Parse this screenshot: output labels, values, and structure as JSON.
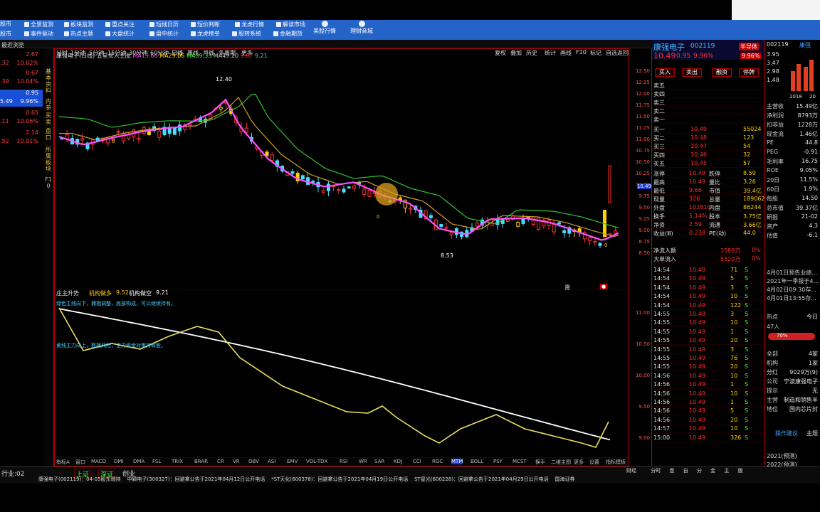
{
  "toolbar": {
    "row1": [
      "全景监测",
      "板块监测",
      "重点关注",
      "短线日历",
      "短价判断",
      "龙虎行情",
      "解读市场"
    ],
    "row2": [
      "事件驱动",
      "热点主题",
      "大盘统计",
      "盘中统计",
      "龙虎榜单",
      "股转系统",
      "金融期货",
      "美股行情",
      "理财商城"
    ],
    "left_labels": [
      "股市",
      "股市"
    ]
  },
  "left_panel": {
    "header": [
      "最近浏览"
    ],
    "rows": [
      {
        "a": "",
        "b": "2.67"
      },
      {
        "a": ".32",
        "b": "10.02%"
      },
      {
        "a": "",
        "b": "0.67"
      },
      {
        "a": ".39",
        "b": "10.04%"
      },
      {
        "a": "",
        "b": "0.95"
      },
      {
        "a": "5.49",
        "b": "9.96%"
      },
      {
        "a": "",
        "b": "0.65"
      },
      {
        "a": ".11",
        "b": "10.06%"
      },
      {
        "a": "",
        "b": "2.14"
      },
      {
        "a": ".52",
        "b": "10.01%"
      }
    ]
  },
  "vtabs": [
    "基本资料",
    "内参",
    "买卖",
    "盘口",
    "所属板块",
    "F10"
  ],
  "chart_header": {
    "periods": [
      "分时",
      "1分钟",
      "5分钟",
      "15分钟",
      "30分钟",
      "60分钟",
      "日线",
      "周线",
      "月线",
      "多周期",
      "更多"
    ],
    "right_tools": [
      "复权",
      "叠加",
      "历史",
      "统计",
      "画线",
      "F10",
      "标记",
      "自选",
      "返回"
    ],
    "stock_label": "康强电子(日线)",
    "indicator": "五星买入主图",
    "ma": [
      {
        "name": "MA1",
        "val": "9.66",
        "color": "#ff40ff"
      },
      {
        "name": "MA2",
        "val": "9.06",
        "color": "#ffd000"
      },
      {
        "name": "MA3",
        "val": "9.33",
        "color": "#40ff40"
      },
      {
        "name": "MA4",
        "val": "9.20",
        "color": "#c0c0c0"
      },
      {
        "name": "",
        "val": "9.87",
        "color": "#ff3030"
      },
      {
        "name": "",
        "val": "9.21",
        "color": "#40d0ff"
      }
    ]
  },
  "chart_data": {
    "type": "line",
    "price_high_label": "12.40",
    "price_low_label": "8.53",
    "tick_marks": [
      "0",
      "0",
      "0"
    ]
  },
  "indicator_panel": {
    "title": "庄主升势",
    "label1": "机构做多",
    "val1": "9.52",
    "label2": "机构做空",
    "val2": "9.21",
    "note1": "绿色主线向下，拥抱调整，底部构成，可以继续持有。",
    "note2": "黄线主力向上，数据风险，主力资金对策持有股。",
    "marker": "贤"
  },
  "bottom_tabs": [
    "指标A",
    "窗口",
    "MACD",
    "DMI",
    "DMA",
    "FSL",
    "TRIX",
    "BRAR",
    "CR",
    "VR",
    "OBV",
    "ASI",
    "EMV",
    "VOL-TDX",
    "RSI",
    "WR",
    "SAR",
    "KDJ",
    "CCI",
    "ROC",
    "MTM",
    "BOLL",
    "PSY",
    "MCST",
    "换手",
    "二维主图",
    "更多",
    "设置"
  ],
  "bottom_tabs_right": "指标模板",
  "axis_prices": [
    "12.50",
    "12.25",
    "12.00",
    "11.75",
    "11.50",
    "11.25",
    "11.00",
    "10.75",
    "10.50",
    "10.25",
    "10.00",
    "9.75",
    "9.50",
    "9.25",
    "9.00",
    "8.75",
    "8.50"
  ],
  "axis_lower": [
    "11.00",
    "10.50",
    "10.00",
    "9.50",
    "9.00"
  ],
  "quote": {
    "name": "康强电子",
    "code": "002119",
    "price": "10.49",
    "change": "0.95",
    "pct": "9.96%",
    "flag": "半导体",
    "flag2": "9.96%",
    "buttons": [
      "买入",
      "卖出",
      "融资",
      "停牌"
    ],
    "sell": [
      "卖五",
      "卖四",
      "卖三",
      "卖二",
      "卖一"
    ],
    "buy": [
      {
        "k": "买一",
        "p": "10.49",
        "v": "55024"
      },
      {
        "k": "买二",
        "p": "10.48",
        "v": "123"
      },
      {
        "k": "买三",
        "p": "10.47",
        "v": "54"
      },
      {
        "k": "买四",
        "p": "10.46",
        "v": "32"
      },
      {
        "k": "买五",
        "p": "10.45",
        "v": "57"
      }
    ],
    "stats": [
      {
        "k1": "涨停",
        "v1": "10.49",
        "k2": "跌停",
        "v2": "8.59"
      },
      {
        "k1": "最高",
        "v1": "10.49",
        "k2": "量比",
        "v2": "3.26"
      },
      {
        "k1": "最低",
        "v1": "9.66",
        "k2": "市值",
        "v2": "39.4亿"
      },
      {
        "k1": "现量",
        "v1": "326",
        "k2": "总量",
        "v2": "189062"
      },
      {
        "k1": "外盘",
        "v1": "102810",
        "k2": "内盘",
        "v2": "86244"
      },
      {
        "k1": "换手",
        "v1": "5.14%",
        "k2": "股本",
        "v2": "3.75亿"
      },
      {
        "k1": "净资",
        "v1": "2.59",
        "k2": "流通",
        "v2": "3.66亿"
      },
      {
        "k1": "收益(Ⅲ)",
        "v1": "0.238",
        "k2": "PE(动)",
        "v2": "44.0"
      }
    ],
    "flow": [
      {
        "k": "净流入额",
        "v": "1589万",
        "p": "0%"
      },
      {
        "k": "大单流入",
        "v": "5520万",
        "p": "0%"
      }
    ],
    "ticks": [
      {
        "t": "14:54",
        "p": "10.49",
        "v": "71",
        "s": "S"
      },
      {
        "t": "14:54",
        "p": "10.49",
        "v": "5",
        "s": "S"
      },
      {
        "t": "14:54",
        "p": "10.49",
        "v": "3",
        "s": "S"
      },
      {
        "t": "14:54",
        "p": "10.49",
        "v": "10",
        "s": "S"
      },
      {
        "t": "14:54",
        "p": "10.49",
        "v": "122",
        "s": "S"
      },
      {
        "t": "14:55",
        "p": "10.49",
        "v": "3",
        "s": "S"
      },
      {
        "t": "14:55",
        "p": "10.49",
        "v": "10",
        "s": "S"
      },
      {
        "t": "14:55",
        "p": "10.49",
        "v": "1",
        "s": "S"
      },
      {
        "t": "14:55",
        "p": "10.49",
        "v": "20",
        "s": "S"
      },
      {
        "t": "14:55",
        "p": "10.49",
        "v": "3",
        "s": "S"
      },
      {
        "t": "14:55",
        "p": "10.49",
        "v": "76",
        "s": "S"
      },
      {
        "t": "14:55",
        "p": "10.49",
        "v": "20",
        "s": "S"
      },
      {
        "t": "14:56",
        "p": "10.49",
        "v": "10",
        "s": "S"
      },
      {
        "t": "14:56",
        "p": "10.49",
        "v": "1",
        "s": "S"
      },
      {
        "t": "14:56",
        "p": "10.49",
        "v": "10",
        "s": "S"
      },
      {
        "t": "14:56",
        "p": "10.49",
        "v": "1",
        "s": "S"
      },
      {
        "t": "14:56",
        "p": "10.49",
        "v": "5",
        "s": "S"
      },
      {
        "t": "14:56",
        "p": "10.49",
        "v": "20",
        "s": "S"
      },
      {
        "t": "14:57",
        "p": "10.49",
        "v": "10",
        "s": "S"
      },
      {
        "t": "15:00",
        "p": "10.49",
        "v": "326",
        "s": "S"
      }
    ]
  },
  "fin": {
    "code": "002119",
    "tag": "康强",
    "bars": [
      "3.95",
      "3.47",
      "2.98",
      "1.48"
    ],
    "years": [
      "2018",
      "20"
    ],
    "rows": [
      {
        "k": "主营收",
        "v": "15.49亿"
      },
      {
        "k": "净利润",
        "v": "8793万"
      },
      {
        "k": "扣非益",
        "v": "1228万"
      },
      {
        "k": "现金流",
        "v": "1.46亿"
      },
      {
        "k": "PE",
        "v": "44.8"
      },
      {
        "k": "PEG",
        "v": "-0.91"
      },
      {
        "k": "毛利率",
        "v": "16.75"
      },
      {
        "k": "ROE",
        "v": "9.05%"
      },
      {
        "k": "20日",
        "v": "11.5%"
      },
      {
        "k": "60日",
        "v": "1.9%"
      },
      {
        "k": "每股",
        "v": "14.50"
      },
      {
        "k": "总市值",
        "v": "39.37亿"
      },
      {
        "k": "研报",
        "v": "21-02"
      },
      {
        "k": "资产",
        "v": "4.3"
      },
      {
        "k": "估值",
        "v": "-6.1"
      }
    ],
    "news": [
      "4月01日预告业绩...",
      "2021年一季报于4...",
      "4月02日09:30存...",
      "4月01日13:55存..."
    ],
    "hot": "热点",
    "today": "今日",
    "hot_count": "47人",
    "pct_badge": "70%",
    "misc": [
      {
        "k": "全部",
        "v": "4家"
      },
      {
        "k": "机构",
        "v": "1家"
      },
      {
        "k": "分红",
        "v": "9029万(9)"
      },
      {
        "k": "公司",
        "v": "宁波康强电子"
      },
      {
        "k": "提示",
        "v": "无"
      },
      {
        "k": "主营",
        "v": "制造和销售半"
      },
      {
        "k": "地位",
        "v": "国内芯片封"
      }
    ],
    "link": "操作建议",
    "link2": "主题",
    "reports": [
      "2021(预测)",
      "2022(预测)"
    ]
  },
  "statusbar": {
    "left": [
      "行业:02",
      "上证",
      "深证",
      "创业"
    ],
    "news": [
      "康强电子(002119)：04-05股东增持",
      "中颖电子(300327)：回避拿公告于2021年04月12日公开电话",
      "*ST天化(600378)：回避拿公告于2021年04月19日公开电话",
      "ST星光(600228)：回避拿公告于2021年04月29日公开电话",
      "国海证券"
    ],
    "right_tabs": [
      "财经",
      "分时",
      "盘",
      "自",
      "分",
      "金",
      "主",
      "版"
    ]
  }
}
